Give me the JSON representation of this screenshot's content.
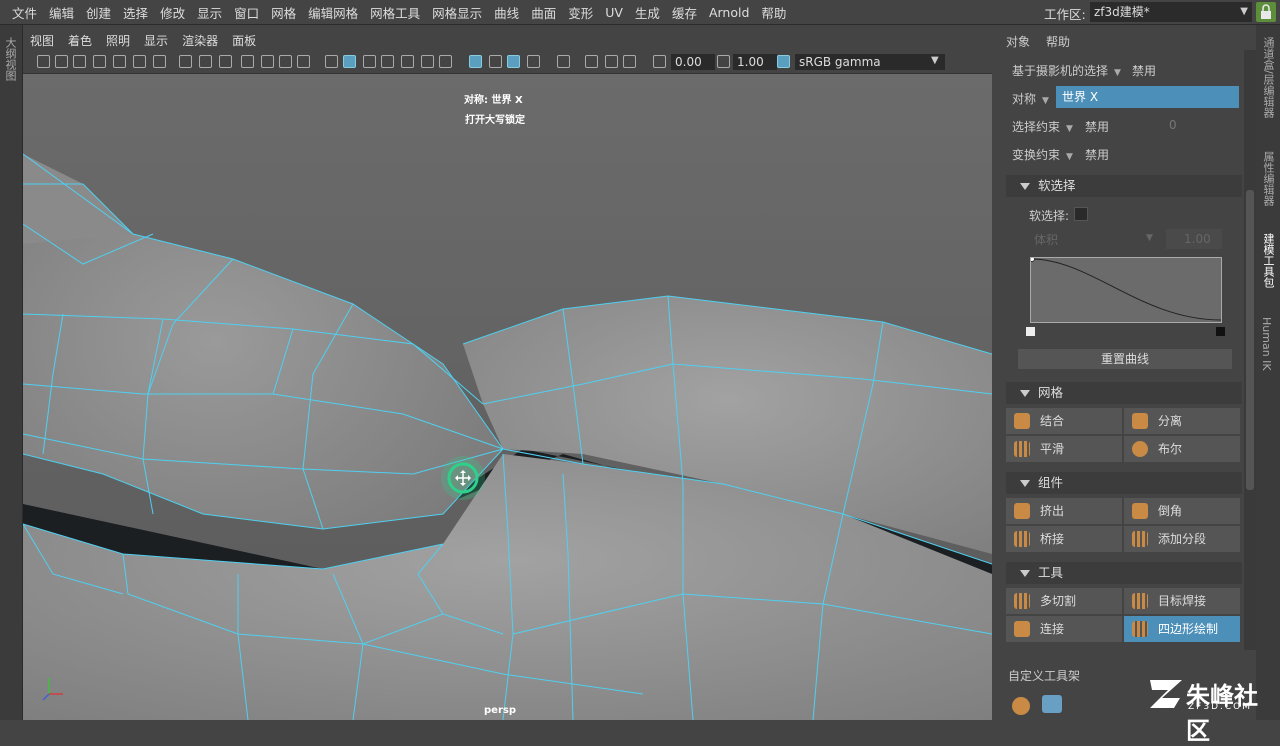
{
  "menubar": {
    "items": [
      "文件",
      "编辑",
      "创建",
      "选择",
      "修改",
      "显示",
      "窗口",
      "网格",
      "编辑网格",
      "网格工具",
      "网格显示",
      "曲线",
      "曲面",
      "变形",
      "UV",
      "生成",
      "缓存",
      "Arnold",
      "帮助"
    ],
    "workspace_label": "工作区:",
    "workspace_value": "zf3d建模*"
  },
  "left_strip": {
    "label": "大纲视图"
  },
  "viewport": {
    "menu": [
      "视图",
      "着色",
      "照明",
      "显示",
      "渲染器",
      "面板"
    ],
    "toolbar": {
      "exposure": "0.00",
      "gamma": "1.00",
      "colorspace": "sRGB gamma"
    },
    "hud_line1": "对称: 世界 X",
    "hud_line2": "打开大写锁定",
    "camera": "persp"
  },
  "right_panel": {
    "menu": [
      "对象",
      "帮助"
    ],
    "camera_based_selection": {
      "label": "基于摄影机的选择",
      "value": "禁用"
    },
    "symmetry": {
      "label": "对称",
      "value": "世界 X"
    },
    "select_constraint": {
      "label": "选择约束",
      "value": "禁用",
      "number": "0"
    },
    "transform_constraint": {
      "label": "变换约束",
      "value": "禁用"
    },
    "soft_select": {
      "header": "软选择",
      "checkbox_label": "软选择:",
      "falloff_mode": "体积",
      "falloff_value": "1.00",
      "reset_button": "重置曲线"
    },
    "mesh": {
      "header": "网格",
      "buttons": [
        "结合",
        "分离",
        "平滑",
        "布尔"
      ]
    },
    "components": {
      "header": "组件",
      "buttons": [
        "挤出",
        "倒角",
        "桥接",
        "添加分段"
      ]
    },
    "tools": {
      "header": "工具",
      "buttons": [
        "多切割",
        "目标焊接",
        "连接",
        "四边形绘制"
      ]
    },
    "custom_shelf": "自定义工具架"
  },
  "right_tabs": [
    "通道盒/层编辑器",
    "属性编辑器",
    "建模工具包",
    "Human IK"
  ],
  "watermark": {
    "main": "朱峰社区",
    "sub": "ZF3D.COM"
  },
  "colors": {
    "wire": "#4fd0f0",
    "accent": "#4c8fb8",
    "background": "#444444"
  }
}
